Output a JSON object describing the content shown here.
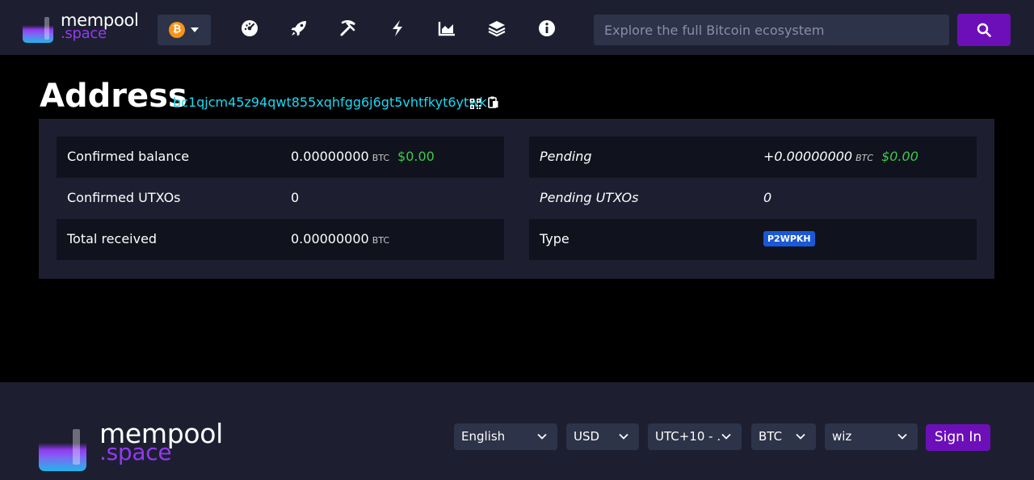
{
  "header": {
    "logo": {
      "line1": "mempool",
      "line2": ".space"
    },
    "network": {
      "icon": "bitcoin-icon",
      "symbol": "₿"
    },
    "nav": [
      {
        "name": "dashboard-icon"
      },
      {
        "name": "rocket-icon"
      },
      {
        "name": "mining-pickaxe-icon"
      },
      {
        "name": "lightning-icon"
      },
      {
        "name": "graphs-icon"
      },
      {
        "name": "blocks-stack-icon"
      },
      {
        "name": "info-icon"
      }
    ],
    "search": {
      "placeholder": "Explore the full Bitcoin ecosystem",
      "value": ""
    }
  },
  "page": {
    "title": "Address",
    "address": "bc1qjcm45z94qwt855xqhfgg6j6gt5vhtfkyt6ytwk"
  },
  "details": {
    "left": [
      {
        "label": "Confirmed balance",
        "value": "0.00000000",
        "unit": "BTC",
        "usd": "$0.00"
      },
      {
        "label": "Confirmed UTXOs",
        "value": "0"
      },
      {
        "label": "Total received",
        "value": "0.00000000",
        "unit": "BTC"
      }
    ],
    "right": [
      {
        "label": "Pending",
        "value": "+0.00000000",
        "unit": "BTC",
        "usd": "$0.00"
      },
      {
        "label": "Pending UTXOs",
        "value": "0"
      },
      {
        "label": "Type",
        "badge": "P2WPKH"
      }
    ]
  },
  "footer": {
    "logo": {
      "line1": "mempool",
      "line2": ".space"
    },
    "selects": {
      "language": "English",
      "currency": "USD",
      "timezone": "UTC+10 - .",
      "denomination": "BTC",
      "theme": "wiz"
    },
    "signin": "Sign In"
  },
  "colors": {
    "accent": "#6c0fb8",
    "link": "#1bd8f4",
    "usd_green": "#3bcc49",
    "badge_blue": "#1a59d6",
    "panel": "#1d1f31",
    "row_shade": "#10121d"
  }
}
